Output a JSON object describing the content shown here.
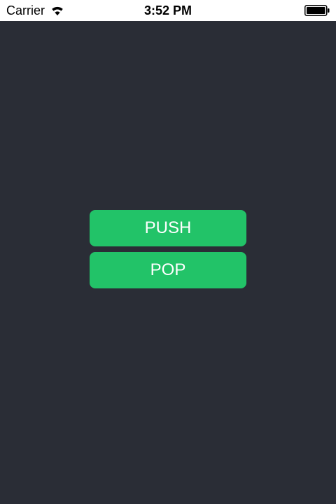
{
  "status_bar": {
    "carrier": "Carrier",
    "time": "3:52 PM",
    "wifi_icon": "wifi-icon",
    "battery_icon": "battery-full-icon"
  },
  "main": {
    "background_color": "#2a2d36",
    "buttons": [
      {
        "label": "PUSH",
        "color": "#22c368"
      },
      {
        "label": "POP",
        "color": "#22c368"
      }
    ]
  }
}
